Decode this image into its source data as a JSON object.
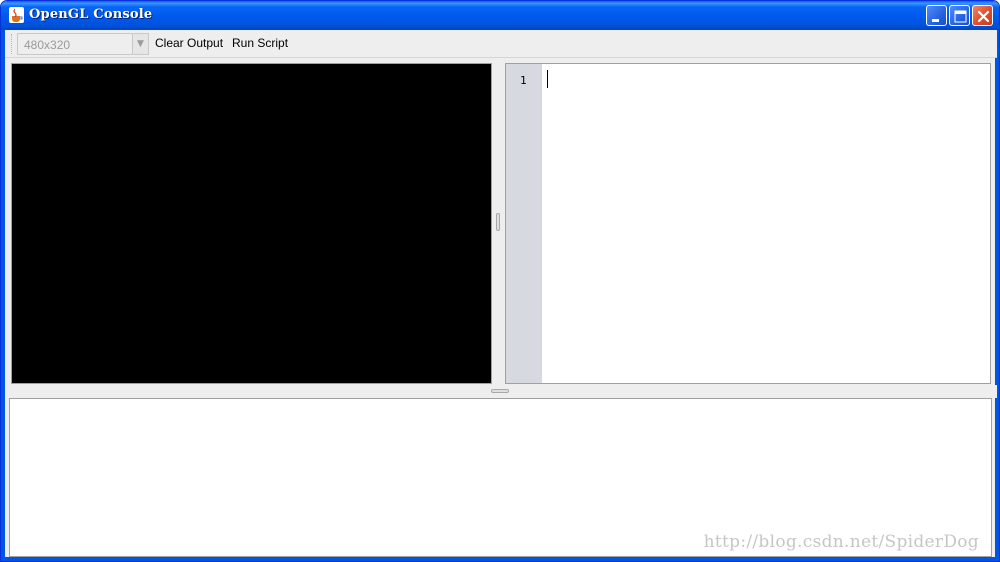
{
  "window": {
    "title": "OpenGL Console",
    "app_icon": "java-cup-icon"
  },
  "title_buttons": {
    "minimize_icon": "minimize-icon",
    "maximize_icon": "maximize-icon",
    "close_icon": "close-icon"
  },
  "toolbar": {
    "resolution_value": "480x320",
    "clear_output_label": "Clear Output",
    "run_script_label": "Run Script"
  },
  "editor": {
    "line_numbers": [
      "1"
    ],
    "content": ""
  },
  "output": {
    "content": ""
  },
  "watermark": "http://blog.csdn.net/SpiderDog",
  "colors": {
    "titlebar_blue": "#0058ee",
    "close_red": "#e1522f",
    "render_background": "#000000",
    "gutter": "#d6d9df"
  }
}
